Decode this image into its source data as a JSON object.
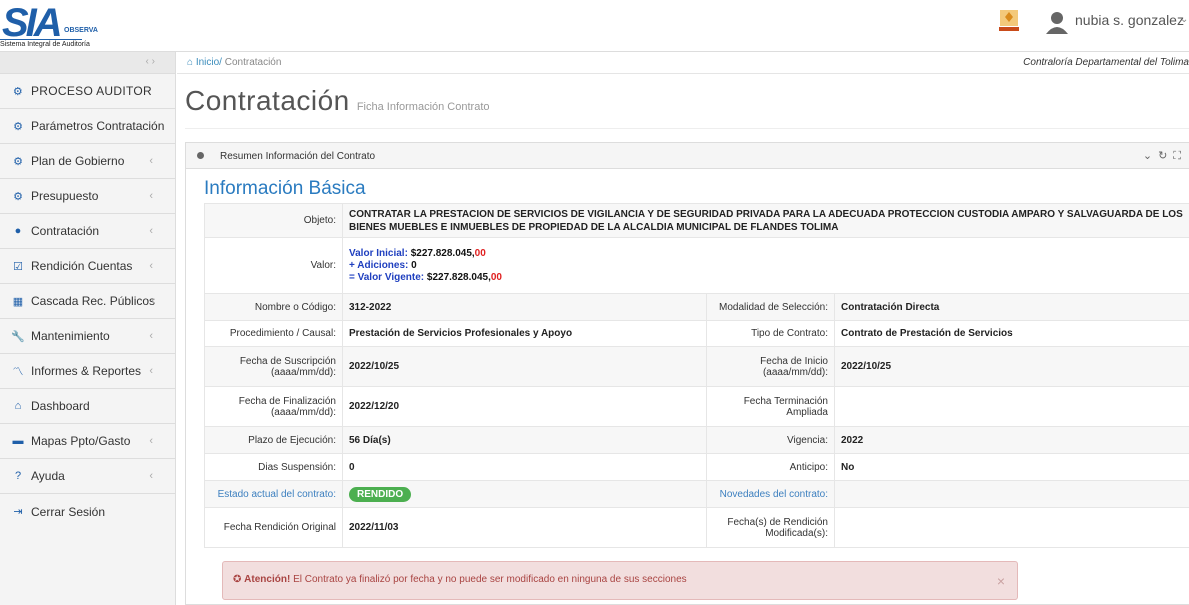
{
  "header": {
    "logo_main": "SIA",
    "logo_tag": "OBSERVA",
    "logo_sub": "Sistema Integral de Auditoría",
    "user_name": "nubia s. gonzalez ."
  },
  "sidebar": {
    "items": [
      {
        "label": "PROCESO AUDITOR",
        "icon": "cogs-icon"
      },
      {
        "label": "Parámetros Contratación",
        "icon": "cogs-icon"
      },
      {
        "label": "Plan de Gobierno",
        "icon": "cogs-icon"
      },
      {
        "label": "Presupuesto",
        "icon": "cogs-icon"
      },
      {
        "label": "Contratación",
        "icon": "circle-icon"
      },
      {
        "label": "Rendición Cuentas",
        "icon": "check-icon"
      },
      {
        "label": "Cascada Rec. Públicos",
        "icon": "grid-icon"
      },
      {
        "label": "Mantenimiento",
        "icon": "wrench-icon"
      },
      {
        "label": "Informes & Reportes",
        "icon": "chart-icon"
      },
      {
        "label": "Dashboard",
        "icon": "home-icon"
      },
      {
        "label": "Mapas Ppto/Gasto",
        "icon": "card-icon"
      },
      {
        "label": "Ayuda",
        "icon": "help-icon"
      },
      {
        "label": "Cerrar Sesión",
        "icon": "logout-icon"
      }
    ]
  },
  "breadcrumb": {
    "home": "Inicio/",
    "current": "Contratación",
    "org": "Contraloría Departamental del Tolima"
  },
  "page": {
    "title": "Contratación",
    "subtitle": "Ficha Información Contrato"
  },
  "portlet": {
    "title": "Resumen Información del Contrato",
    "section": "Información Básica"
  },
  "contract": {
    "objeto_label": "Objeto:",
    "objeto": "CONTRATAR LA PRESTACION DE SERVICIOS DE VIGILANCIA Y DE SEGURIDAD PRIVADA PARA LA ADECUADA PROTECCION CUSTODIA AMPARO Y SALVAGUARDA DE LOS BIENES MUEBLES E INMUEBLES DE PROPIEDAD DE LA ALCALDIA MUNICIPAL DE FLANDES TOLIMA",
    "valor_label": "Valor:",
    "valor_inicial_label": "Valor Inicial:",
    "valor_inicial": "$227.828.045,",
    "valor_inicial_cents": "00",
    "adiciones_label": "+ Adiciones:",
    "adiciones": "0",
    "valor_vigente_label": "= Valor Vigente:",
    "valor_vigente": "$227.828.045,",
    "valor_vigente_cents": "00",
    "nombre_label": "Nombre o Código:",
    "nombre": "312-2022",
    "modalidad_label": "Modalidad de Selección:",
    "modalidad": "Contratación Directa",
    "procedimiento_label": "Procedimiento / Causal:",
    "procedimiento": "Prestación de Servicios Profesionales y Apoyo",
    "tipo_label": "Tipo de Contrato:",
    "tipo": "Contrato de Prestación de Servicios",
    "suscripcion_label": "Fecha de Suscripción (aaaa/mm/dd):",
    "suscripcion": "2022/10/25",
    "inicio_label": "Fecha de Inicio (aaaa/mm/dd):",
    "inicio": "2022/10/25",
    "finalizacion_label": "Fecha de Finalización (aaaa/mm/dd):",
    "finalizacion": "2022/12/20",
    "terminacion_label": "Fecha Terminación Ampliada",
    "terminacion": "",
    "plazo_label": "Plazo de Ejecución:",
    "plazo": "56 Día(s)",
    "vigencia_label": "Vigencia:",
    "vigencia": "2022",
    "suspension_label": "Dias Suspensión:",
    "suspension": "0",
    "anticipo_label": "Anticipo:",
    "anticipo": "No",
    "estado_label": "Estado actual del contrato:",
    "estado": "RENDIDO",
    "novedades_label": "Novedades del contrato:",
    "novedades": "",
    "rendicion_label": "Fecha Rendición Original",
    "rendicion": "2022/11/03",
    "rendicion_mod_label": "Fecha(s) de Rendición Modificada(s):",
    "rendicion_mod": ""
  },
  "alert": {
    "strong": "Atención!",
    "text": "El Contrato ya finalizó por fecha y no puede ser modificado en ninguna de sus secciones",
    "close": "×"
  },
  "colors": {
    "accent": "#3c8dbc",
    "brand": "#1f5fa9",
    "badge_green": "#4caf50",
    "alert_bg": "#f2dede"
  }
}
